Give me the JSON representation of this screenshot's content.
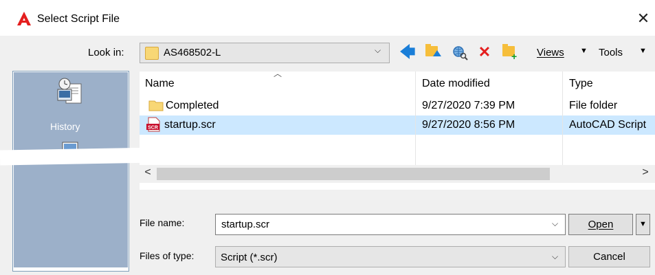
{
  "window": {
    "title": "Select Script File",
    "close_glyph": "✕",
    "logo_icon": "autocad-a-logo",
    "logo_color": "#e41e1e"
  },
  "toolbar": {
    "look_in_label": "Look in:",
    "look_in_value": "AS468502-L",
    "back_icon": "back-arrow-icon",
    "up_icon": "up-folder-icon",
    "search_web_icon": "search-web-icon",
    "delete_icon": "delete-icon",
    "new_folder_icon": "new-folder-icon",
    "views_label": "Views",
    "tools_label": "Tools"
  },
  "places": {
    "history_label": "History",
    "selected_bg": "#9cb0c9"
  },
  "file_list": {
    "columns": [
      "Name",
      "Date modified",
      "Type"
    ],
    "rows": [
      {
        "name": "Completed",
        "date": "9/27/2020 7:39 PM",
        "type": "File folder",
        "icon": "folder-icon",
        "selected": false
      },
      {
        "name": "startup.scr",
        "date": "9/27/2020 8:56 PM",
        "type": "AutoCAD Script",
        "icon": "script-file-icon",
        "selected": true
      }
    ],
    "selection_color": "#cce8ff"
  },
  "form": {
    "file_name_label": "File name:",
    "file_name_value": "startup.scr",
    "files_of_type_label": "Files of type:",
    "files_of_type_value": "Script (*.scr)",
    "open_label": "Open",
    "cancel_label": "Cancel"
  }
}
